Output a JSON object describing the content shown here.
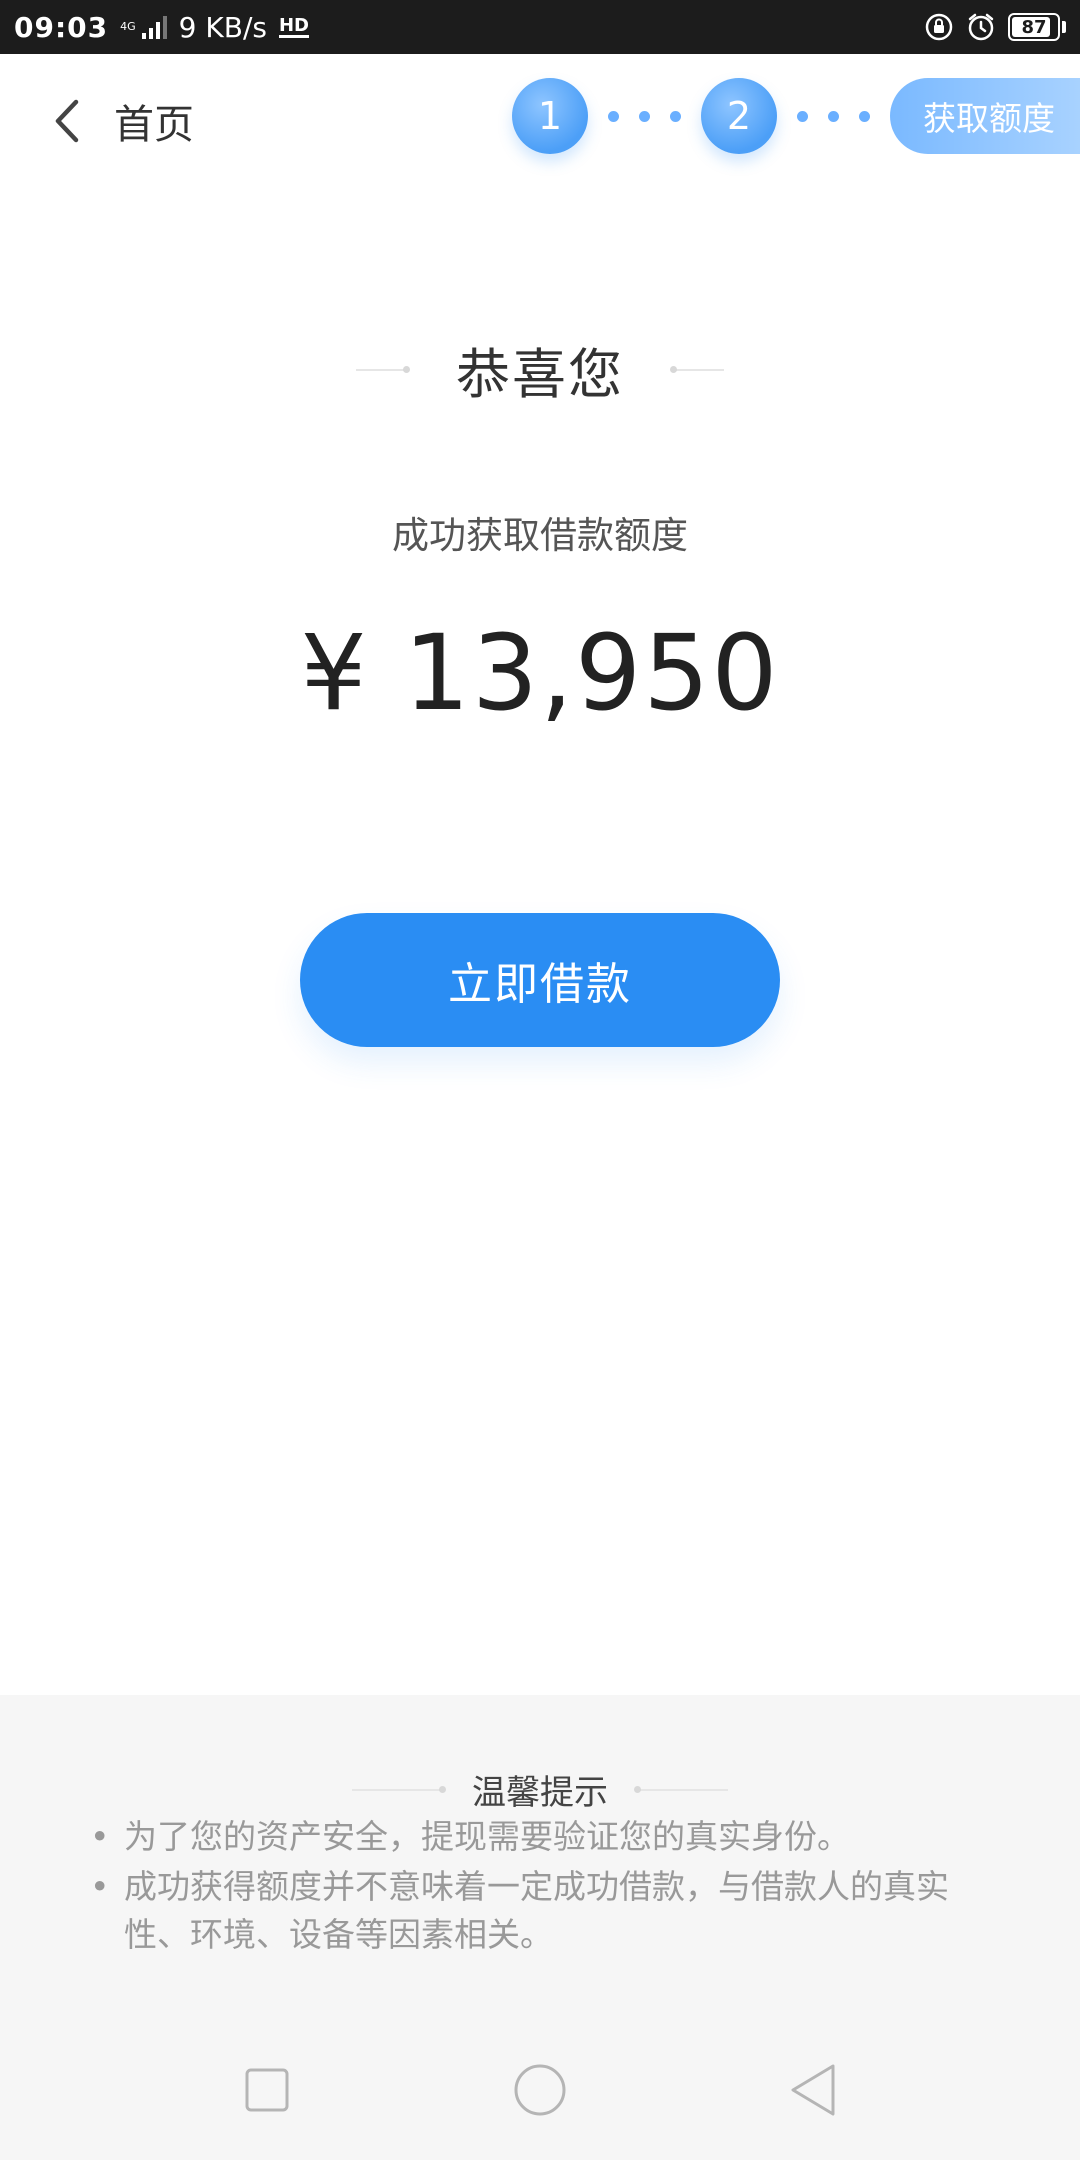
{
  "status_bar": {
    "time": "09:03",
    "network_type": "4G",
    "speed": "9 KB/s",
    "hd": "HD",
    "battery": "87",
    "battery_level": 0.87,
    "icons": [
      "signal-icon",
      "hd-voice-icon",
      "lock-rotation-icon",
      "alarm-icon",
      "battery-icon"
    ]
  },
  "header": {
    "back_label": "首页",
    "steps": [
      {
        "label": "1"
      },
      {
        "label": "2"
      },
      {
        "label": "获取额度"
      }
    ]
  },
  "main": {
    "title": "恭喜您",
    "subtitle": "成功获取借款额度",
    "amount": "¥ 13,950",
    "button_label": "立即借款"
  },
  "tips": {
    "title": "温馨提示",
    "items": [
      "为了您的资产安全，提现需要验证您的真实身份。",
      "成功获得额度并不意味着一定成功借款，与借款人的真实性、环境、设备等因素相关。"
    ]
  },
  "colors": {
    "accent": "#2a8df3",
    "step_light": "#7ab9ff",
    "tips_background": "#f6f6f6"
  }
}
